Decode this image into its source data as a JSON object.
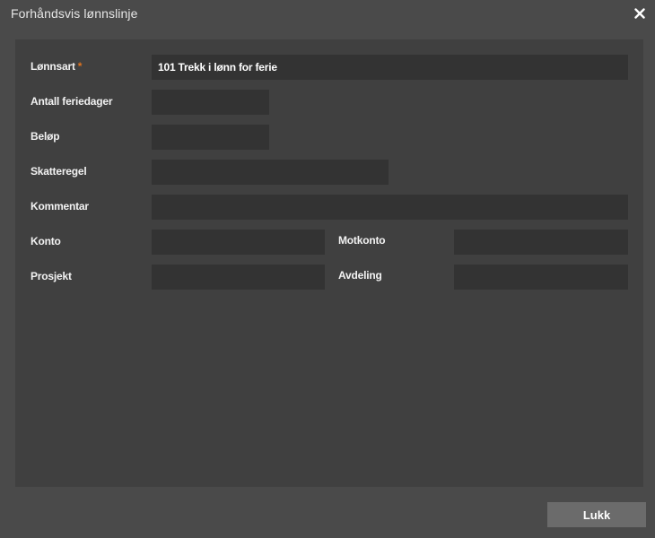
{
  "dialog": {
    "title": "Forhåndsvis lønnslinje",
    "close_icon": "close-icon"
  },
  "form": {
    "lonnsart": {
      "label": "Lønnsart",
      "required_mark": "*",
      "value": "101 Trekk i lønn for ferie"
    },
    "antall_feriedager": {
      "label": "Antall feriedager",
      "value": ""
    },
    "belop": {
      "label": "Beløp",
      "value": ""
    },
    "skatteregel": {
      "label": "Skatteregel",
      "value": ""
    },
    "kommentar": {
      "label": "Kommentar",
      "value": ""
    },
    "konto": {
      "label": "Konto",
      "value": ""
    },
    "motkonto": {
      "label": "Motkonto",
      "value": ""
    },
    "prosjekt": {
      "label": "Prosjekt",
      "value": ""
    },
    "avdeling": {
      "label": "Avdeling",
      "value": ""
    }
  },
  "footer": {
    "close_label": "Lukk"
  },
  "colors": {
    "background": "#4a4a4a",
    "panel": "#404040",
    "field": "#333333",
    "required": "#e0731f",
    "button": "#6b6b6b"
  }
}
